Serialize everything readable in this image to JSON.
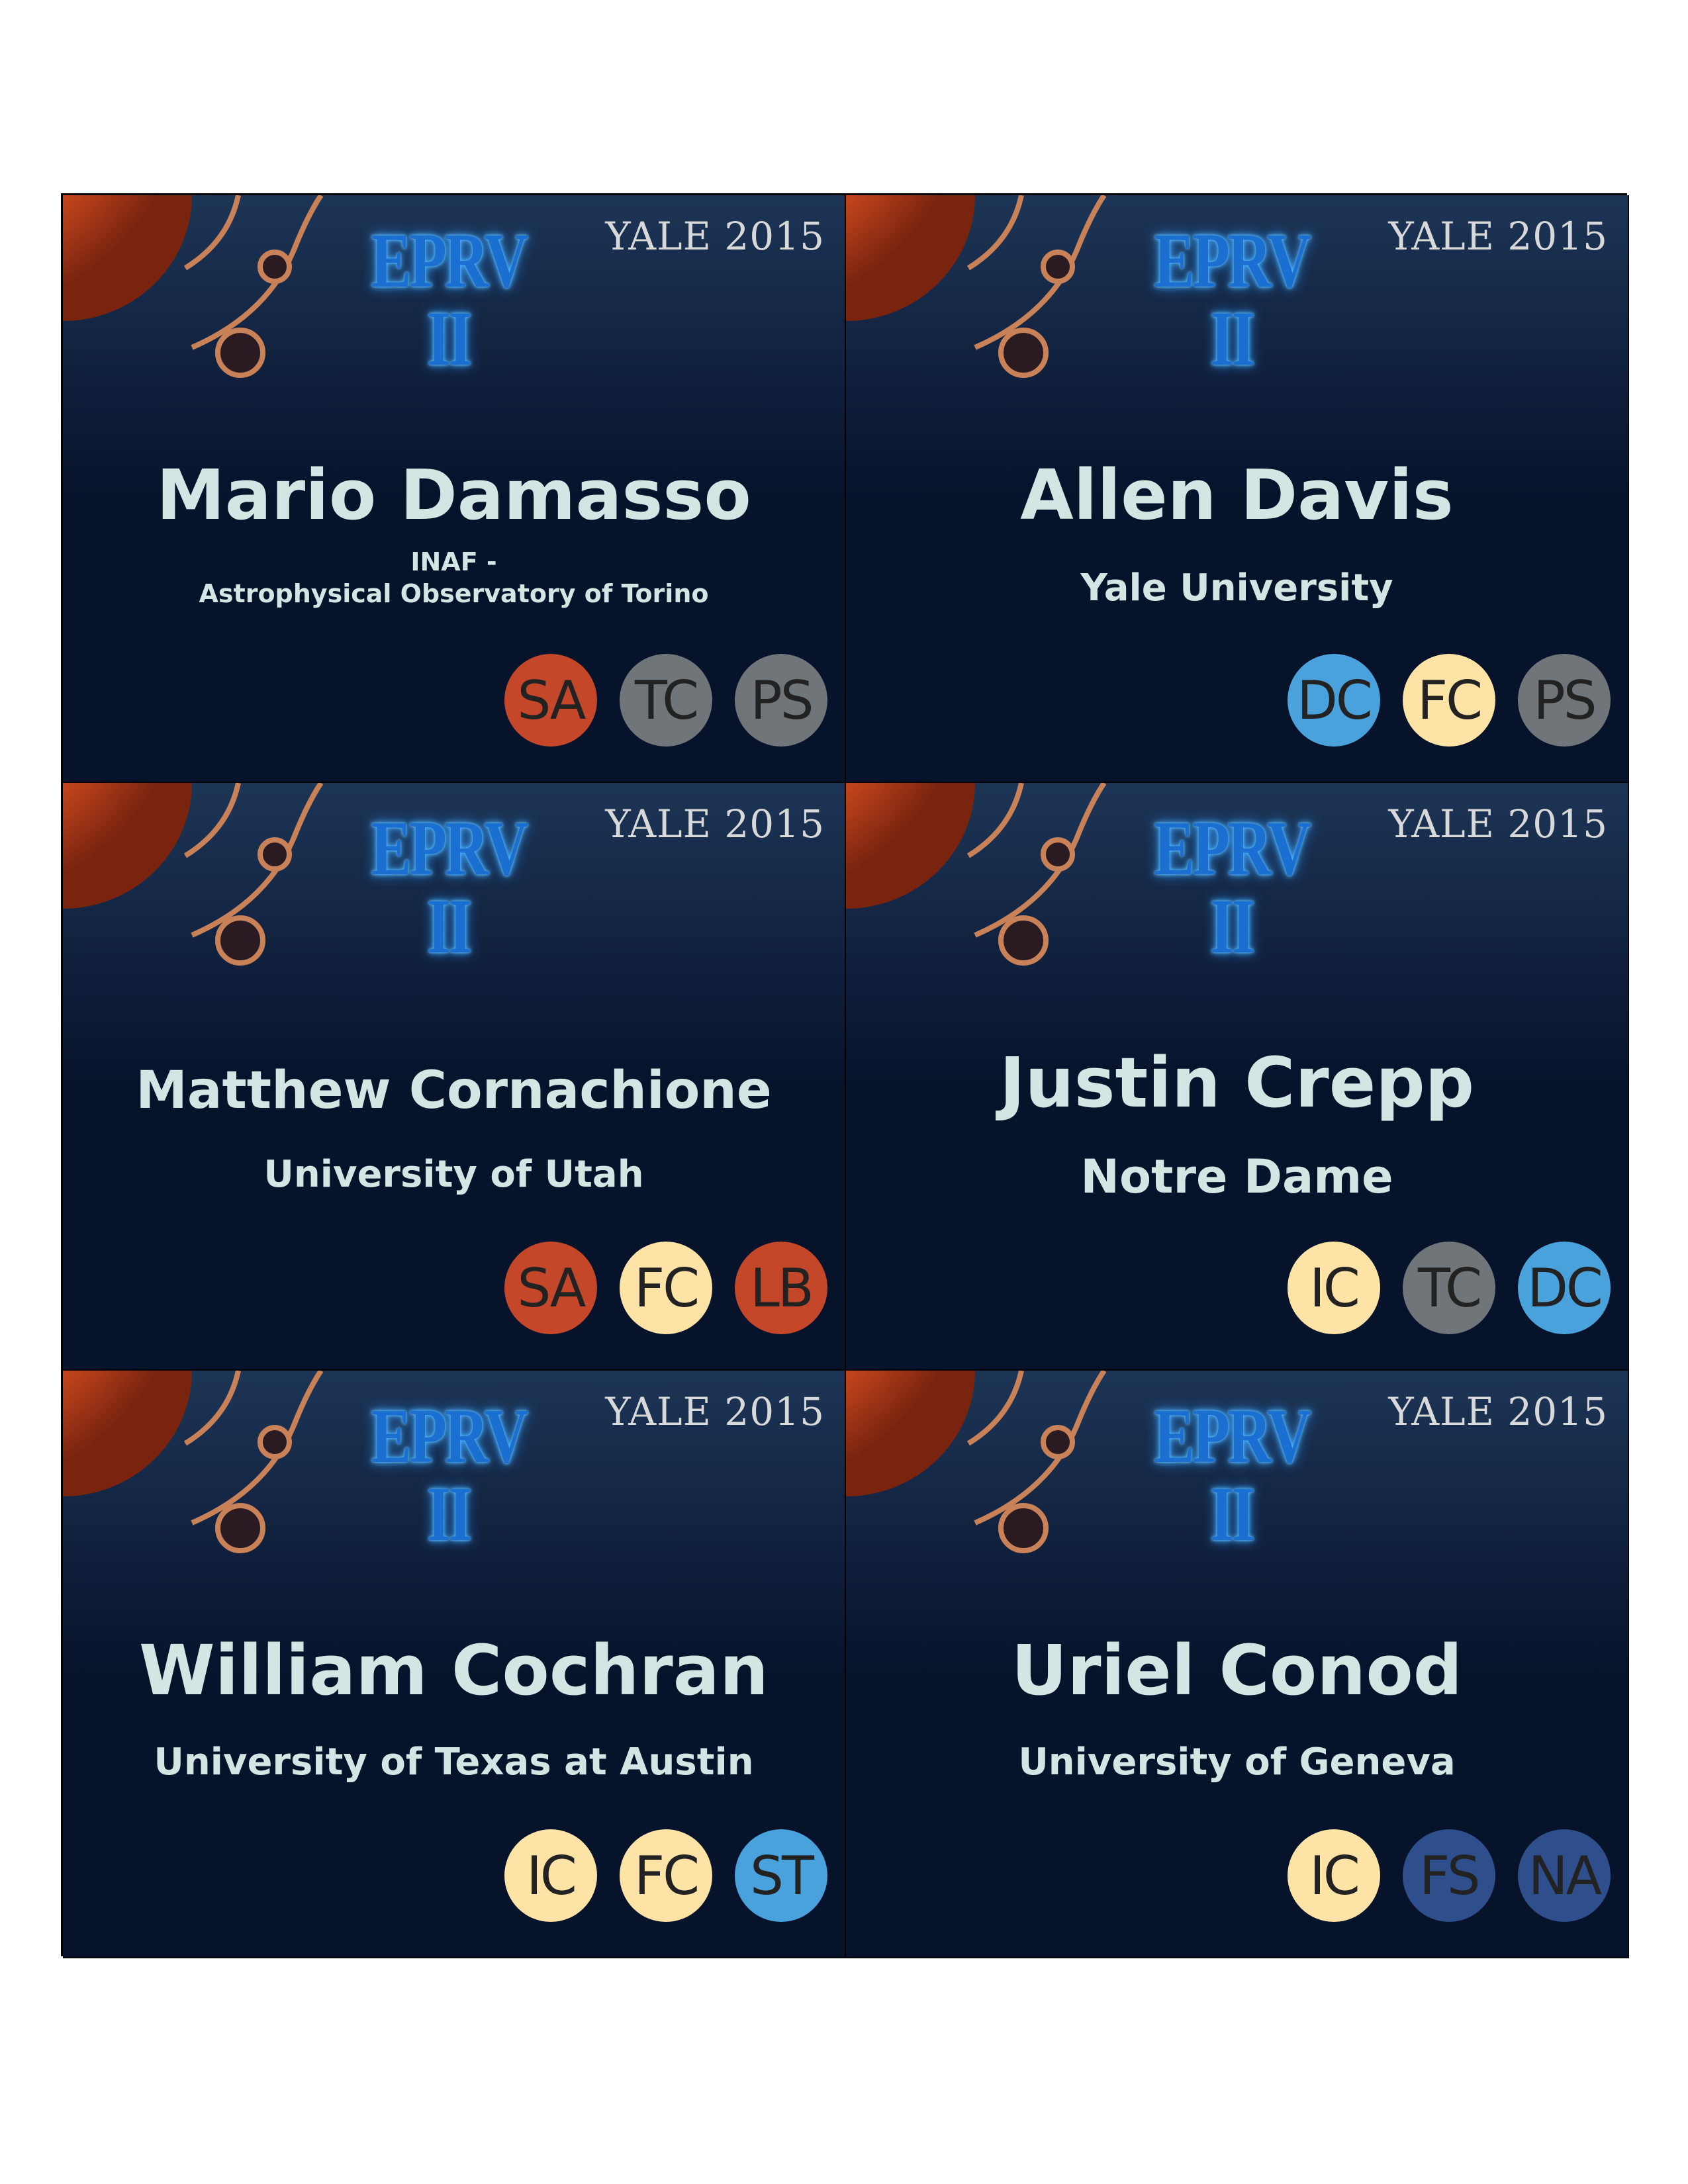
{
  "event": {
    "logo": "EPRV II",
    "venue_year": "YALE 2015"
  },
  "tag_colors": {
    "SA": "#c5472a",
    "TC": "#6f7579",
    "PS": "#6f7579",
    "DC": "#4aa2dd",
    "FC": "#fde3a6",
    "LB": "#c5472a",
    "IC": "#fde3a6",
    "ST": "#4aa2dd",
    "FS": "#2e4f8c",
    "NA": "#2e4f8c"
  },
  "badges": [
    {
      "name": "Mario Damasso",
      "affiliation_line1": "INAF -",
      "affiliation_line2": "Astrophysical Observatory of Torino",
      "tags": [
        "SA",
        "TC",
        "PS"
      ]
    },
    {
      "name": "Allen Davis",
      "affiliation_line1": "Yale University",
      "affiliation_line2": "",
      "tags": [
        "DC",
        "FC",
        "PS"
      ]
    },
    {
      "name": "Matthew Cornachione",
      "affiliation_line1": "University of Utah",
      "affiliation_line2": "",
      "tags": [
        "SA",
        "FC",
        "LB"
      ]
    },
    {
      "name": "Justin Crepp",
      "affiliation_line1": "Notre Dame",
      "affiliation_line2": "",
      "tags": [
        "IC",
        "TC",
        "DC"
      ]
    },
    {
      "name": "William Cochran",
      "affiliation_line1": "University of Texas at Austin",
      "affiliation_line2": "",
      "tags": [
        "IC",
        "FC",
        "ST"
      ]
    },
    {
      "name": "Uriel Conod",
      "affiliation_line1": "University of Geneva",
      "affiliation_line2": "",
      "tags": [
        "IC",
        "FS",
        "NA"
      ]
    }
  ]
}
